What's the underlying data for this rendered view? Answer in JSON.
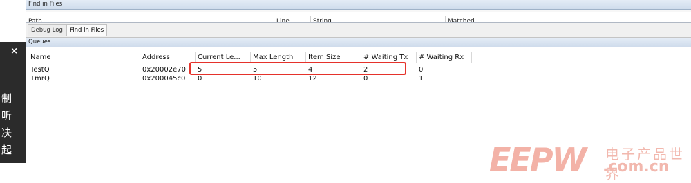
{
  "overlay": {
    "close_glyph": "×",
    "chars": [
      "制",
      "听",
      "决",
      "起"
    ]
  },
  "find_panel": {
    "title": "Find in Files",
    "columns": [
      "Path",
      "Line",
      "String",
      "Matched"
    ]
  },
  "tabs": [
    {
      "label": "Debug Log"
    },
    {
      "label": "Find in Files"
    }
  ],
  "queues": {
    "title": "Queues",
    "columns": [
      "Name",
      "Address",
      "Current Le...",
      "Max Length",
      "Item Size",
      "# Waiting Tx",
      "# Waiting Rx"
    ],
    "rows": [
      [
        "TestQ",
        "0x20002e70",
        "5",
        "5",
        "4",
        "2",
        "0"
      ],
      [
        "TmrQ",
        "0x200045c0",
        "0",
        "10",
        "12",
        "0",
        "1"
      ]
    ]
  },
  "watermark": {
    "logo": "EEPW",
    "cn": "电子产品世界",
    "domain": ".com.cn"
  },
  "colors": {
    "highlight": "#e5322b",
    "watermark": "#f3b2a7"
  }
}
